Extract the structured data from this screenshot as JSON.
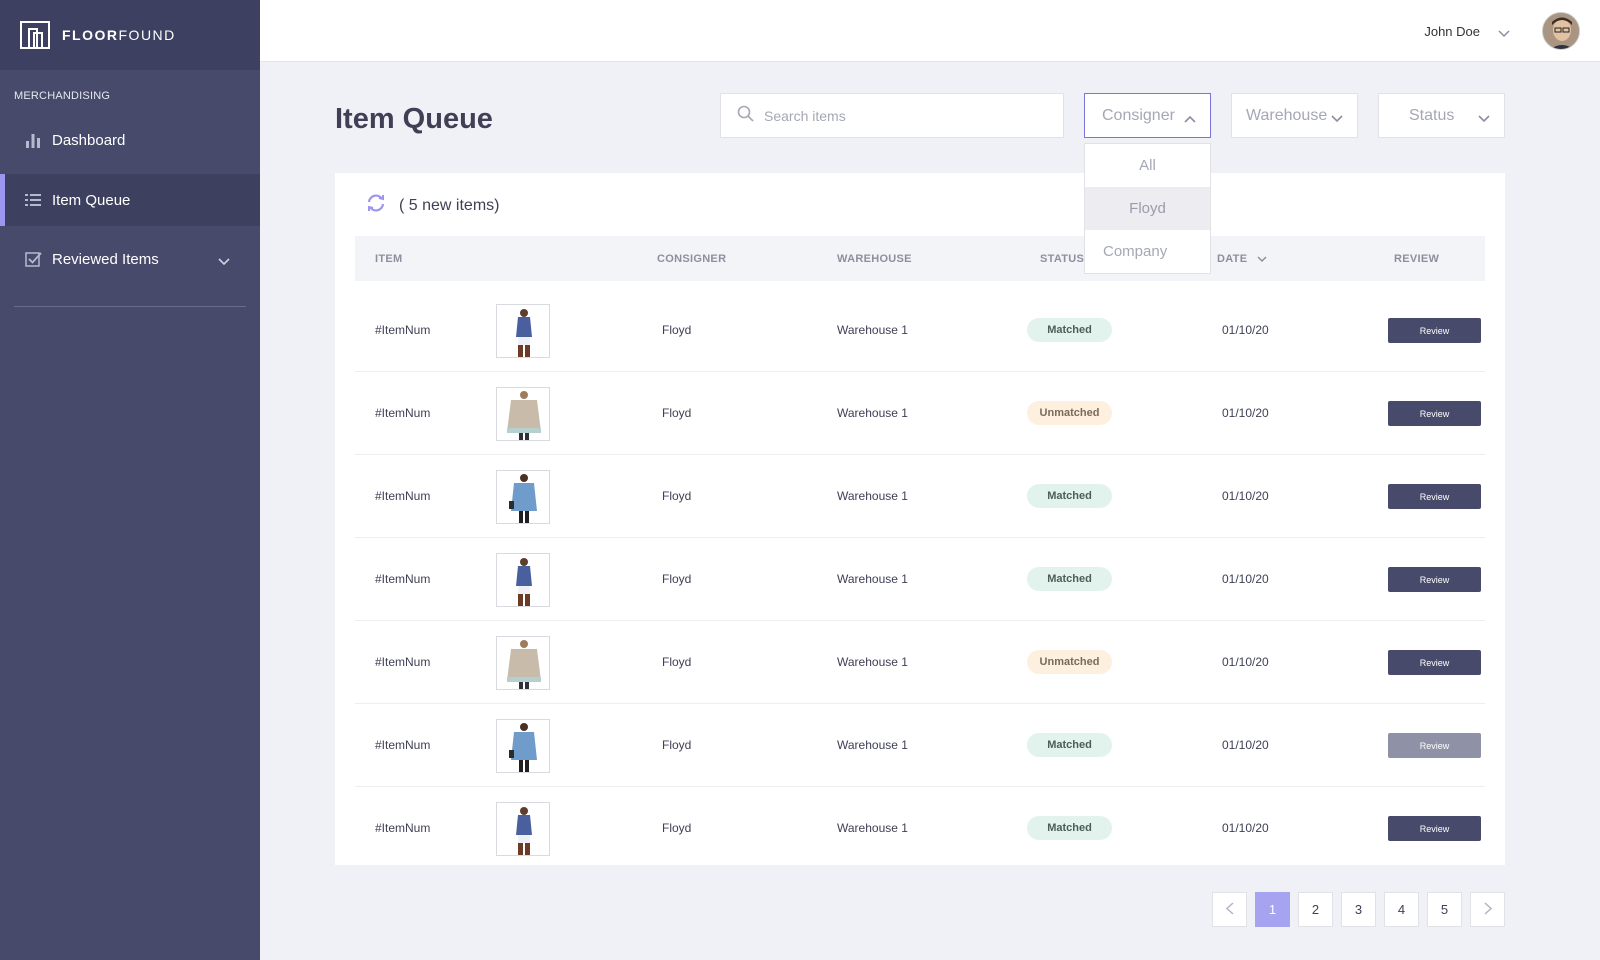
{
  "brand": {
    "name_bold": "FLOOR",
    "name_light": "FOUND"
  },
  "sidebar": {
    "section_label": "MERCHANDISING",
    "items": [
      {
        "label": "Dashboard",
        "icon": "bar-chart-icon"
      },
      {
        "label": "Item Queue",
        "icon": "list-icon",
        "active": true
      },
      {
        "label": "Reviewed Items",
        "icon": "checkbox-icon",
        "expandable": true
      }
    ]
  },
  "header": {
    "user_name": "John Doe"
  },
  "page": {
    "title": "Item Queue"
  },
  "search": {
    "placeholder": "Search items"
  },
  "filters": {
    "consigner": {
      "label": "Consigner",
      "open": true,
      "options": [
        "All",
        "Floyd",
        "Company"
      ],
      "hovered": "Floyd"
    },
    "warehouse": {
      "label": "Warehouse"
    },
    "status": {
      "label": "Status"
    }
  },
  "queue": {
    "new_items_text": "( 5 new items)"
  },
  "table": {
    "headers": {
      "item": "ITEM",
      "consigner": "CONSIGNER",
      "warehouse": "WAREHOUSE",
      "status": "STATUS",
      "date": "DATE",
      "review": "REVIEW"
    },
    "rows": [
      {
        "item": "#ItemNum",
        "image": "blue-dress",
        "consigner": "Floyd",
        "warehouse": "Warehouse 1",
        "status": "Matched",
        "date": "01/10/20",
        "review": "Review"
      },
      {
        "item": "#ItemNum",
        "image": "beige-sweater",
        "consigner": "Floyd",
        "warehouse": "Warehouse 1",
        "status": "Unmatched",
        "date": "01/10/20",
        "review": "Review"
      },
      {
        "item": "#ItemNum",
        "image": "denim-jacket",
        "consigner": "Floyd",
        "warehouse": "Warehouse 1",
        "status": "Matched",
        "date": "01/10/20",
        "review": "Review"
      },
      {
        "item": "#ItemNum",
        "image": "blue-dress",
        "consigner": "Floyd",
        "warehouse": "Warehouse 1",
        "status": "Matched",
        "date": "01/10/20",
        "review": "Review"
      },
      {
        "item": "#ItemNum",
        "image": "beige-sweater",
        "consigner": "Floyd",
        "warehouse": "Warehouse 1",
        "status": "Unmatched",
        "date": "01/10/20",
        "review": "Review"
      },
      {
        "item": "#ItemNum",
        "image": "denim-jacket",
        "consigner": "Floyd",
        "warehouse": "Warehouse 1",
        "status": "Matched",
        "date": "01/10/20",
        "review": "Review",
        "muted": true
      },
      {
        "item": "#ItemNum",
        "image": "blue-dress",
        "consigner": "Floyd",
        "warehouse": "Warehouse 1",
        "status": "Matched",
        "date": "01/10/20",
        "review": "Review"
      }
    ]
  },
  "pagination": {
    "pages": [
      "1",
      "2",
      "3",
      "4",
      "5"
    ],
    "current": "1"
  },
  "colors": {
    "sidebar": "#474a6a",
    "accent": "#9b96ee",
    "matched": "#e1f3ec",
    "unmatched": "#fdf0df",
    "review_button": "#474a6a"
  }
}
